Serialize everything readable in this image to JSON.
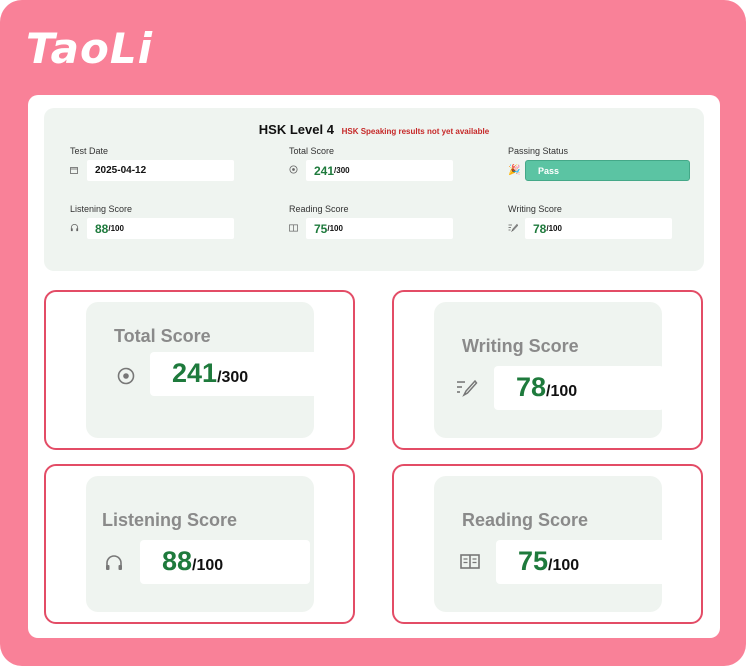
{
  "app": {
    "logo": "TaoLi"
  },
  "summary": {
    "title": "HSK Level 4",
    "notice": "HSK Speaking results not yet available",
    "test_date": {
      "label": "Test Date",
      "value": "2025-04-12",
      "icon": "calendar-icon"
    },
    "total_score": {
      "label": "Total Score",
      "score": "241",
      "max": "/300",
      "icon": "target-icon"
    },
    "passing_status": {
      "label": "Passing Status",
      "value": "Pass",
      "icon": "party-popper-icon"
    },
    "listening_score": {
      "label": "Listening Score",
      "score": "88",
      "max": "/100",
      "icon": "headphones-icon"
    },
    "reading_score": {
      "label": "Reading Score",
      "score": "75",
      "max": "/100",
      "icon": "book-icon"
    },
    "writing_score": {
      "label": "Writing Score",
      "score": "78",
      "max": "/100",
      "icon": "pencil-icon"
    }
  },
  "zoom": {
    "total": {
      "label": "Total Score",
      "score": "241",
      "max": "/300"
    },
    "writing": {
      "label": "Writing Score",
      "score": "78",
      "max": "/100"
    },
    "listening": {
      "label": "Listening Score",
      "score": "88",
      "max": "/100"
    },
    "reading": {
      "label": "Reading Score",
      "score": "75",
      "max": "/100"
    }
  },
  "colors": {
    "background": "#f98198",
    "panel": "#eff4f0",
    "score_green": "#1e7a3c",
    "pass_green": "#5bc4a3",
    "highlight_border": "#e34c66",
    "warning_red": "#c62828"
  }
}
